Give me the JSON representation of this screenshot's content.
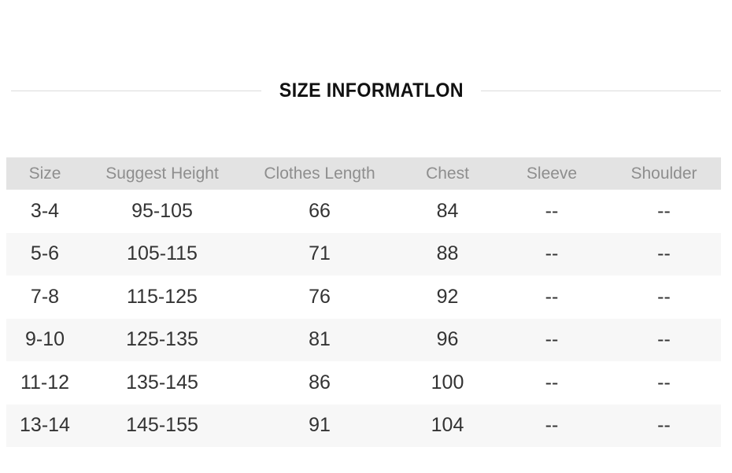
{
  "title": {
    "text": "SIZE INFORMATLON",
    "rule_color": "#dcdcdc"
  },
  "table": {
    "header_background": "#e3e3e3",
    "header_text_color": "#8e8e8e",
    "stripe_color": "#f7f7f7",
    "body_text_color": "#333333",
    "columns": [
      "Size",
      "Suggest Height",
      "Clothes Length",
      "Chest",
      "Sleeve",
      "Shoulder"
    ],
    "rows": [
      [
        "3-4",
        "95-105",
        "66",
        "84",
        "--",
        "--"
      ],
      [
        "5-6",
        "105-115",
        "71",
        "88",
        "--",
        "--"
      ],
      [
        "7-8",
        "115-125",
        "76",
        "92",
        "--",
        "--"
      ],
      [
        "9-10",
        "125-135",
        "81",
        "96",
        "--",
        "--"
      ],
      [
        "11-12",
        "135-145",
        "86",
        "100",
        "--",
        "--"
      ],
      [
        "13-14",
        "145-155",
        "91",
        "104",
        "--",
        "--"
      ]
    ]
  }
}
